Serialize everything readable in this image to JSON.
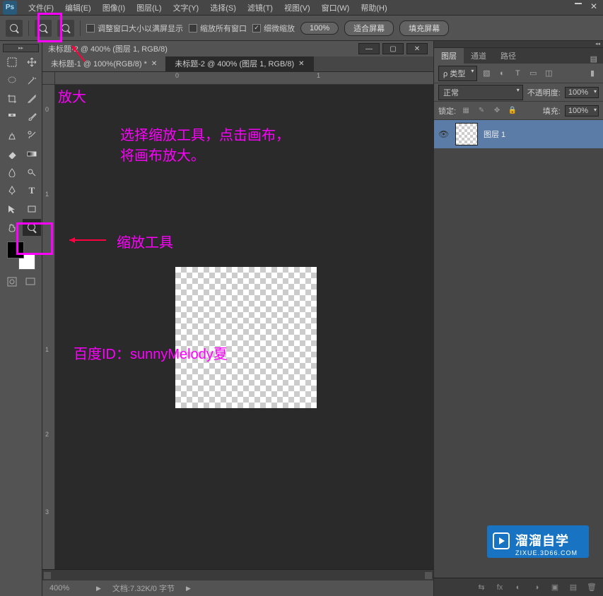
{
  "app_logo_text": "Ps",
  "menu": {
    "file": "文件(F)",
    "edit": "编辑(E)",
    "image": "图像(I)",
    "layer": "图层(L)",
    "text": "文字(Y)",
    "select": "选择(S)",
    "filter": "滤镜(T)",
    "view": "视图(V)",
    "window": "窗口(W)",
    "help": "帮助(H)"
  },
  "options": {
    "fit_window": "调整窗口大小以满屏显示",
    "zoom_all": "缩放所有窗口",
    "scrub_zoom": "细微缩放",
    "btn_100": "100%",
    "fit_screen": "适合屏幕",
    "fill_screen": "填充屏幕"
  },
  "document": {
    "title": "未标题-2 @ 400% (图层 1, RGB/8)",
    "tab1": "未标题-1 @ 100%(RGB/8) *",
    "tab2": "未标题-2 @ 400% (图层 1, RGB/8)"
  },
  "ruler_h": {
    "l0": "0",
    "l1": "1"
  },
  "ruler_v": {
    "l0": "0",
    "l1": "1",
    "l2": "2",
    "l3": "3"
  },
  "status": {
    "zoom": "400%",
    "doc_size_label": "文档:",
    "doc_size": "7.32K/0 字节"
  },
  "panels": {
    "layers_tab": "图层",
    "channel_tab": "通道",
    "path_tab": "路径",
    "filter_kind": "ρ 类型",
    "blend_mode": "正常",
    "opacity_label": "不透明度:",
    "opacity_val": "100%",
    "lock_label": "锁定:",
    "fill_label": "填充:",
    "fill_val": "100%",
    "layer1_name": "图层 1"
  },
  "annotations": {
    "zoom_in": "放大",
    "instruction_l1": "选择缩放工具，点击画布，",
    "instruction_l2": "将画布放大。",
    "zoom_tool": "缩放工具",
    "author": "百度ID：sunnyMelody夏"
  },
  "watermark": {
    "title": "溜溜自学",
    "sub": "ZIXUE.3D66.COM"
  }
}
